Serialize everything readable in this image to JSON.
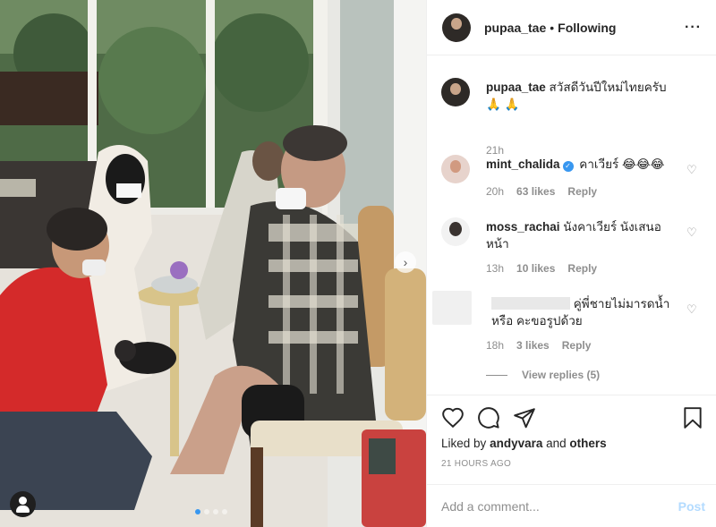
{
  "post": {
    "username": "pupaa_tae",
    "separator": "•",
    "follow_status": "Following",
    "more_icon": "more-options-icon",
    "caption_text": "สวัสดีวันปีใหม่ไทยครับ 🙏 🙏",
    "caption_age": "21h"
  },
  "comments": [
    {
      "username": "mint_chalida",
      "verified": true,
      "text": "คาเวียร์ 😂😂😂",
      "age": "20h",
      "likes": "63 likes",
      "reply": "Reply"
    },
    {
      "username": "moss_rachai",
      "verified": false,
      "text": "นังคาเวียร์ นังเสนอหน้า",
      "age": "13h",
      "likes": "10 likes",
      "reply": "Reply"
    },
    {
      "username": "",
      "verified": false,
      "text": "คู่พี่ชายไม่มารดน้ำหรือ คะขอรูปด้วย",
      "age": "18h",
      "likes": "3 likes",
      "reply": "Reply"
    }
  ],
  "view_replies": "View replies (5)",
  "actions": {
    "icons": [
      "heart-icon",
      "comment-icon",
      "share-icon",
      "bookmark-icon"
    ],
    "liked_prefix": "Liked by",
    "liked_user": "andyvara",
    "liked_joiner": "and",
    "liked_others": "others",
    "timestamp": "21 HOURS AGO"
  },
  "add_comment": {
    "placeholder": "Add a comment...",
    "post_label": "Post"
  },
  "colors": {
    "verified": "#3897f0",
    "post_disabled": "#b3dbff",
    "secondary_text": "#8e8e8e",
    "primary_text": "#262626"
  },
  "carousel": {
    "slides": 4,
    "active": 1
  }
}
